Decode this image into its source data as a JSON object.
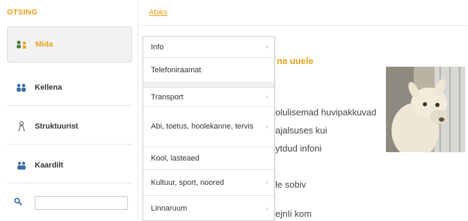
{
  "sidebar": {
    "title": "OTSING",
    "items": [
      {
        "label": "Mida",
        "icon": "people-icon"
      },
      {
        "label": "Kellena",
        "icon": "group-icon"
      },
      {
        "label": "Struktuurist",
        "icon": "person-icon"
      },
      {
        "label": "Kaardilt",
        "icon": "map-icon"
      }
    ],
    "search": {
      "value": "",
      "placeholder": ""
    }
  },
  "breadcrumb": "Abiks",
  "menu": {
    "items": [
      {
        "label": "Info",
        "has_submenu": true
      },
      {
        "label": "Telefoniraamat",
        "has_submenu": false
      },
      {
        "label": "Transport",
        "has_submenu": true
      },
      {
        "label": "Abi, toetus, hoolekanne, tervis",
        "has_submenu": true
      },
      {
        "label": "Kool, lasteaed",
        "has_submenu": false
      },
      {
        "label": "Kultuur, sport, noored",
        "has_submenu": true
      },
      {
        "label": "Linnaruum",
        "has_submenu": true
      }
    ]
  },
  "content": {
    "heading": "na uuele",
    "lines": [
      "olulisemad huvipakkuvad",
      "ajalsuses kui",
      "ytdud infoni",
      "le sobiv",
      "ejnIi kom"
    ]
  },
  "colors": {
    "accent": "#e8a21a"
  }
}
